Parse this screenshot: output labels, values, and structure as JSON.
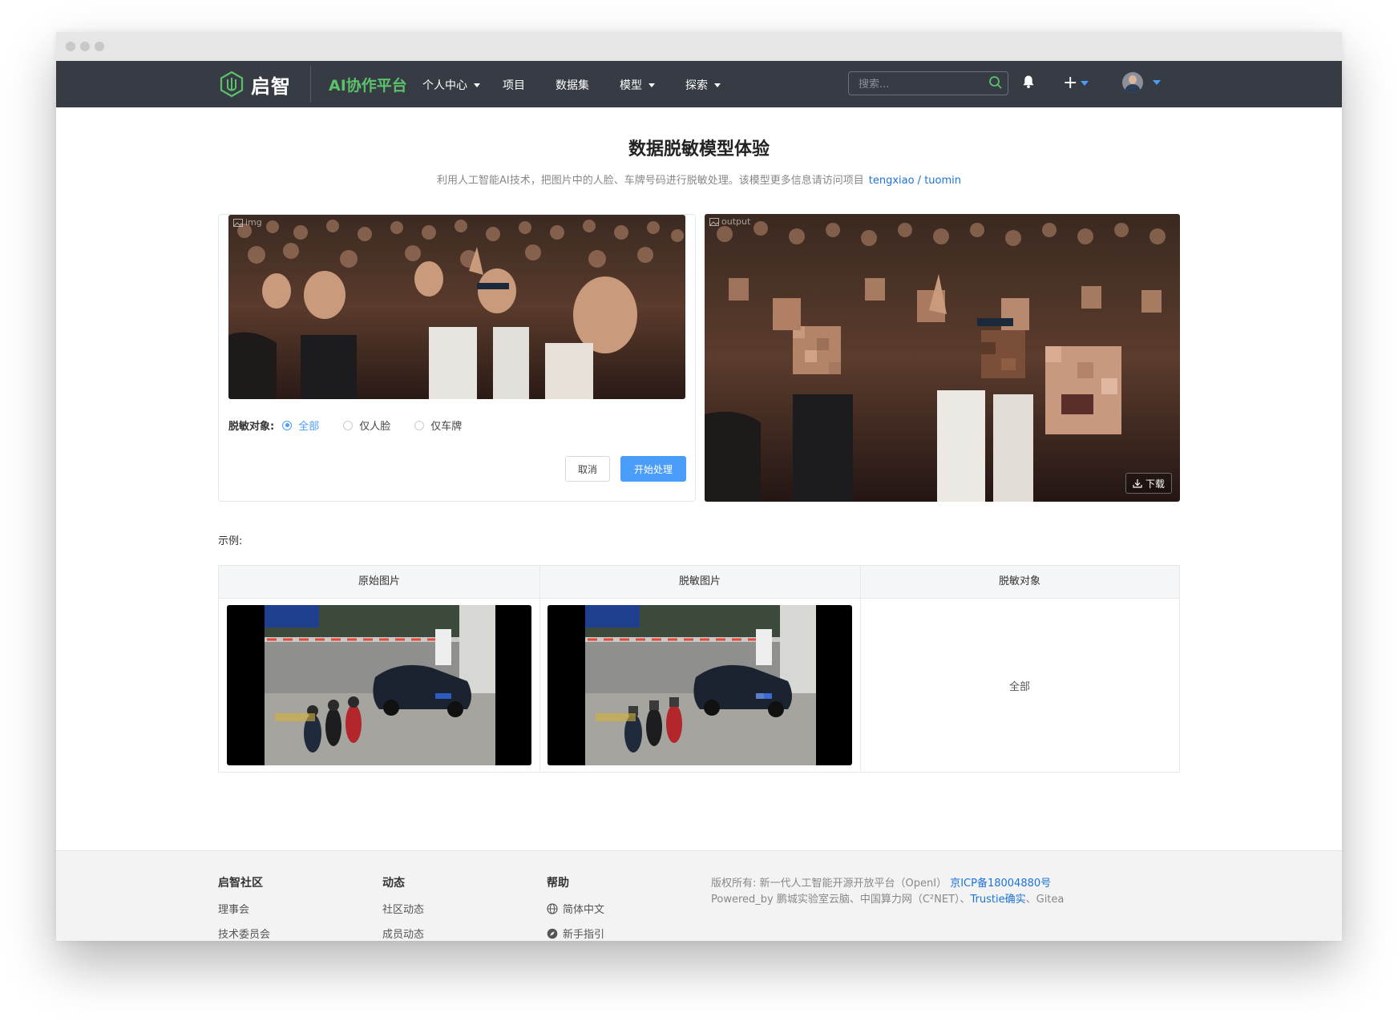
{
  "nav": {
    "logo_text": "启智",
    "platform": "AI协作平台",
    "items": [
      {
        "label": "个人中心",
        "dropdown": true
      },
      {
        "label": "项目",
        "dropdown": false
      },
      {
        "label": "数据集",
        "dropdown": false
      },
      {
        "label": "模型",
        "dropdown": true
      },
      {
        "label": "探索",
        "dropdown": true
      }
    ],
    "search_placeholder": "搜索..."
  },
  "page": {
    "title": "数据脱敏模型体验",
    "subtitle": "利用人工智能AI技术，把图片中的人脸、车牌号码进行脱敏处理。该模型更多信息请访问项目",
    "project_link": "tengxiao / tuomin"
  },
  "input_panel": {
    "image_label": "img",
    "radio_title": "脱敏对象:",
    "options": [
      "全部",
      "仅人脸",
      "仅车牌"
    ],
    "selected": "全部",
    "cancel_label": "取消",
    "start_label": "开始处理"
  },
  "output_panel": {
    "image_label": "output",
    "download_label": "下载"
  },
  "examples": {
    "label": "示例:",
    "columns": [
      "原始图片",
      "脱敏图片",
      "脱敏对象"
    ],
    "rows": [
      {
        "target": "全部"
      }
    ]
  },
  "footer": {
    "col1_title": "启智社区",
    "col1_links": [
      "理事会",
      "技术委员会"
    ],
    "col2_title": "动态",
    "col2_links": [
      "社区动态",
      "成员动态"
    ],
    "col3_title": "帮助",
    "col3_links": [
      "简体中文",
      "新手指引"
    ],
    "copyright": "版权所有: 新一代人工智能开源开放平台（OpenI）",
    "icp": "京ICP备18004880号",
    "powered": "Powered_by 鹏城实验室云脑、中国算力网（C²NET）、",
    "trustie": "Trustie确实",
    "gitea": "、Gitea"
  },
  "colors": {
    "navbar_bg": "#363b44",
    "brand_green": "#5bc26b",
    "primary_blue": "#4a9df8",
    "link_blue": "#1a73d8"
  }
}
